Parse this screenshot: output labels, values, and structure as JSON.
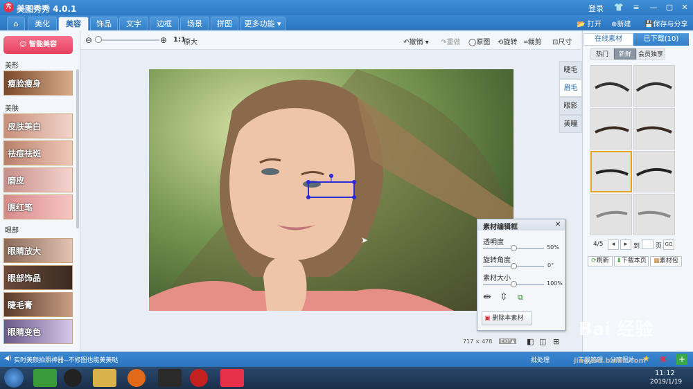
{
  "app": {
    "logo": "秀",
    "title": "美图秀秀 4.0.1",
    "login": "登录",
    "win_min": "—",
    "win_max": "▢",
    "win_close": "✕"
  },
  "nav": {
    "home_icon": "home-icon",
    "tabs": [
      "美化",
      "美容",
      "饰品",
      "文字",
      "边框",
      "场景",
      "拼图",
      "更多功能 ▾"
    ],
    "active_tab": "美容",
    "open": "打开",
    "new": "新建",
    "save": "保存与分享"
  },
  "toolbar": {
    "zoom_ratio": "1:1",
    "original_size": "原大",
    "undo": "撤销",
    "redo": "重做",
    "original": "原图",
    "rotate": "旋转",
    "crop": "裁剪",
    "resize": "尺寸"
  },
  "sidebar": {
    "smart_btn": "智能美容",
    "groups": [
      {
        "title": "美形",
        "items": [
          "瘦脸瘦身"
        ]
      },
      {
        "title": "美肤",
        "items": [
          "皮肤美白",
          "祛痘祛斑",
          "磨皮",
          "腮红笔"
        ]
      },
      {
        "title": "眼部",
        "items": [
          "眼睛放大",
          "眼部饰品",
          "睫毛膏",
          "眼睛变色"
        ]
      }
    ]
  },
  "side_tabs": [
    "睫毛",
    "眉毛",
    "眼影",
    "美瞳"
  ],
  "editor": {
    "title": "素材编辑框",
    "close": "✕",
    "opacity_label": "透明度",
    "opacity_value": "50%",
    "opacity": 0.5,
    "rotate_label": "旋转角度",
    "rotate_value": "0°",
    "rotate": 0.5,
    "size_label": "素材大小",
    "size_value": "100%",
    "size": 0.5,
    "delete": "删除本素材"
  },
  "canvas": {
    "width": "717",
    "times": "×",
    "height": "478",
    "exif": "EXIF▲"
  },
  "right": {
    "tab_online": "在线素材",
    "tab_downloaded": "已下载(10)",
    "filters": [
      "热门",
      "新鲜",
      "会员独享"
    ],
    "active_filter": "新鲜",
    "page": "4/5",
    "to": "到",
    "page_unit": "页",
    "go": "GO",
    "refresh": "刷新",
    "download_page": "下载本页",
    "material_pack": "素材包"
  },
  "status": {
    "left": "实时美颜拍照神器--不修图也能美美哒",
    "batch": "批处理",
    "download_mgr": "下载管理",
    "share": "分享图片"
  },
  "taskbar": {
    "time": "11:12",
    "date": "2019/1/19"
  },
  "watermark": {
    "site": "jingyan.baidu.com",
    "text": "Bai 经验"
  },
  "colors": {
    "accent": "#2f7ac4",
    "pink": "#e6415f",
    "select": "#e8a21a"
  }
}
